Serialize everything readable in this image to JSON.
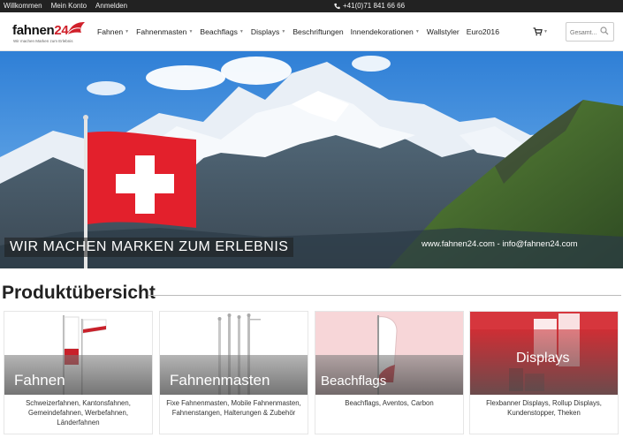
{
  "topbar": {
    "links": [
      "Willkommen",
      "Mein Konto",
      "Anmelden"
    ],
    "phone": "+41(0)71 841 66 66",
    "phone_icon": "phone-icon"
  },
  "header": {
    "logo_text": "fahnen",
    "logo_number": "24",
    "logo_tagline": "Wir machen Marken zum Erlebnis",
    "nav": [
      {
        "label": "Fahnen",
        "dropdown": true
      },
      {
        "label": "Fahnenmasten",
        "dropdown": true
      },
      {
        "label": "Beachflags",
        "dropdown": true
      },
      {
        "label": "Displays",
        "dropdown": true
      },
      {
        "label": "Beschriftungen",
        "dropdown": false
      },
      {
        "label": "Innendekorationen",
        "dropdown": true
      },
      {
        "label": "Wallstyler",
        "dropdown": false
      },
      {
        "label": "Euro2016",
        "dropdown": false
      }
    ],
    "cart_icon": "cart-icon",
    "search_placeholder": "Gesamt..."
  },
  "hero": {
    "slogan": "WIR MACHEN MARKEN ZUM ERLEBNIS",
    "contact": "www.fahnen24.com - info@fahnen24.com"
  },
  "products": {
    "title": "Produktübersicht",
    "cards": [
      {
        "title": "Fahnen",
        "desc": "Schweizerfahnen, Kantonsfahnen, Gemeindefahnen, Werbefahnen, Länderfahnen"
      },
      {
        "title": "Fahnenmasten",
        "desc": "Fixe Fahnenmasten, Mobile Fahnenmasten, Fahnenstangen, Halterungen & Zubehör"
      },
      {
        "title": "Beachflags",
        "desc": "Beachflags, Aventos, Carbon"
      },
      {
        "title": "Displays",
        "desc": "Flexbanner Displays,  Rollup Displays, Kundenstopper, Theken"
      }
    ]
  },
  "colors": {
    "accent": "#d0202a",
    "topbar": "#222222"
  }
}
